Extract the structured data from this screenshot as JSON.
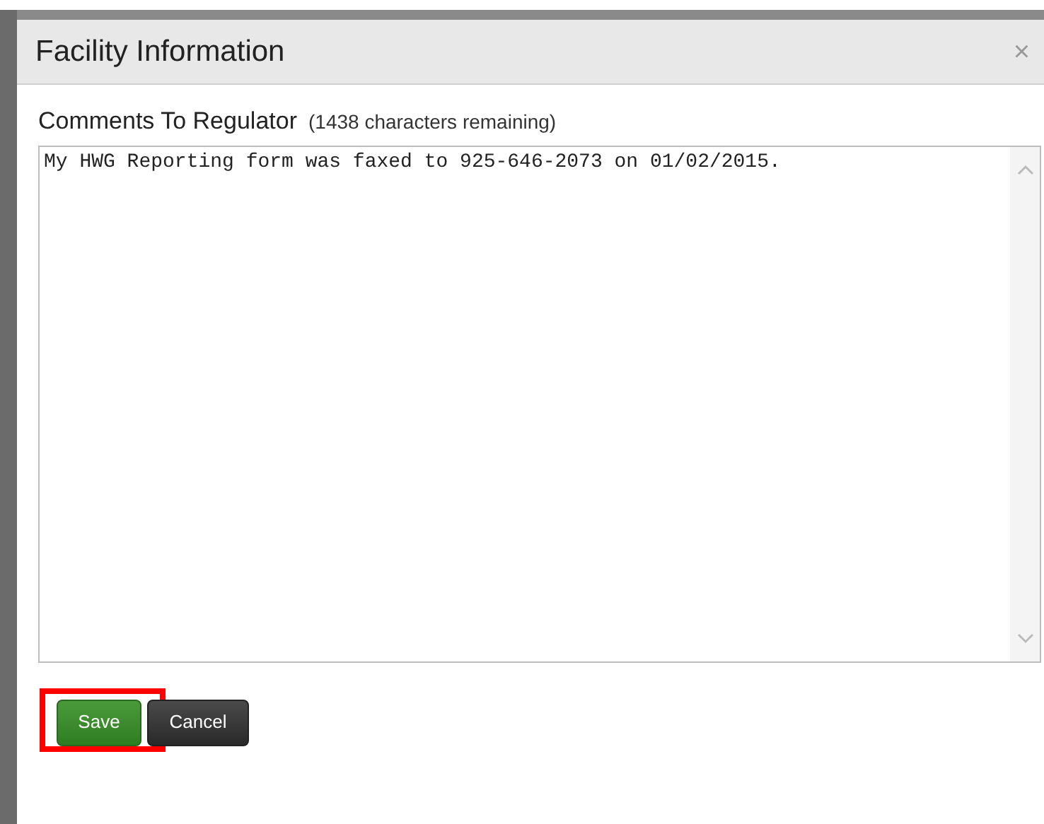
{
  "dialog": {
    "title": "Facility Information",
    "close": "×"
  },
  "comments": {
    "label": "Comments To Regulator",
    "remaining": "(1438 characters remaining)",
    "value": "My HWG Reporting form was faxed to 925-646-2073 on 01/02/2015."
  },
  "buttons": [
    {
      "label": "Save",
      "kind": "primary",
      "highlighted": true
    },
    {
      "label": "Cancel",
      "kind": "secondary",
      "highlighted": false
    }
  ]
}
